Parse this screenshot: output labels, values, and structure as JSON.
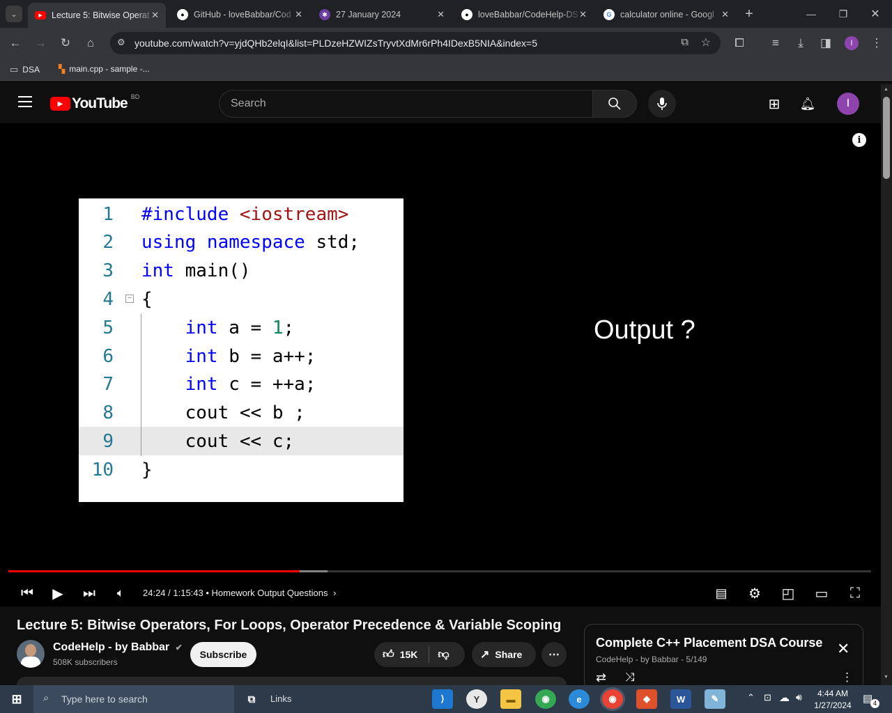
{
  "browser": {
    "tabs": [
      {
        "title": "Lecture 5: Bitwise Operat",
        "active": true
      },
      {
        "title": "GitHub - loveBabbar/Cod",
        "active": false
      },
      {
        "title": "27 January 2024",
        "active": false
      },
      {
        "title": "loveBabbar/CodeHelp-DS",
        "active": false
      },
      {
        "title": "calculator online - Googl",
        "active": false
      }
    ],
    "url": "youtube.com/watch?v=yjdQHb2elqI&list=PLDzeHZWIZsTryvtXdMr6rPh4IDexB5NIA&index=5",
    "profile_initial": "I",
    "bookmarks": [
      {
        "label": "DSA"
      },
      {
        "label": "main.cpp - sample -..."
      }
    ]
  },
  "youtube": {
    "logo": "YouTube",
    "region": "BD",
    "search_placeholder": "Search",
    "avatar_initial": "I"
  },
  "video": {
    "code_lines": [
      {
        "n": "1",
        "tokens": [
          {
            "t": "#include ",
            "c": "kw"
          },
          {
            "t": "<iostream>",
            "c": "str"
          }
        ]
      },
      {
        "n": "2",
        "tokens": [
          {
            "t": "using namespace ",
            "c": "kw"
          },
          {
            "t": "std;",
            "c": ""
          }
        ]
      },
      {
        "n": "3",
        "tokens": [
          {
            "t": "int ",
            "c": "kw"
          },
          {
            "t": "main()",
            "c": ""
          }
        ]
      },
      {
        "n": "4",
        "tokens": [
          {
            "t": "{",
            "c": ""
          }
        ]
      },
      {
        "n": "5",
        "tokens": [
          {
            "t": "    int ",
            "c": "kw"
          },
          {
            "t": "a = ",
            "c": ""
          },
          {
            "t": "1",
            "c": "num"
          },
          {
            "t": ";",
            "c": ""
          }
        ]
      },
      {
        "n": "6",
        "tokens": [
          {
            "t": "    int ",
            "c": "kw"
          },
          {
            "t": "b = a++;",
            "c": ""
          }
        ]
      },
      {
        "n": "7",
        "tokens": [
          {
            "t": "    int ",
            "c": "kw"
          },
          {
            "t": "c = ++a;",
            "c": ""
          }
        ]
      },
      {
        "n": "8",
        "tokens": [
          {
            "t": "    cout << b ;",
            "c": ""
          }
        ]
      },
      {
        "n": "9",
        "tokens": [
          {
            "t": "    cout ",
            "c": ""
          },
          {
            "t": "<< c;",
            "c": ""
          }
        ]
      },
      {
        "n": "10",
        "tokens": [
          {
            "t": "}",
            "c": ""
          }
        ]
      }
    ],
    "output_text": "Output ?",
    "progress": 0.338,
    "buffered": 0.37,
    "time": "24:24 / 1:15:43",
    "chapter": "Homework Output Questions",
    "title": "Lecture 5: Bitwise Operators, For Loops, Operator Precedence & Variable Scoping",
    "channel": "CodeHelp - by Babbar",
    "subscribers": "508K subscribers",
    "subscribe_label": "Subscribe",
    "likes": "15K",
    "share_label": "Share"
  },
  "playlist": {
    "title": "Complete C++ Placement DSA Course",
    "subtitle": "CodeHelp - by Babbar - 5/149"
  },
  "taskbar": {
    "search_placeholder": "Type here to search",
    "links_label": "Links",
    "time": "4:44 AM",
    "date": "1/27/2024",
    "notif_count": "4"
  },
  "colors": {
    "youtube_red": "#ff0000",
    "accent": "#8e44ad",
    "progress_red": "#f00"
  }
}
